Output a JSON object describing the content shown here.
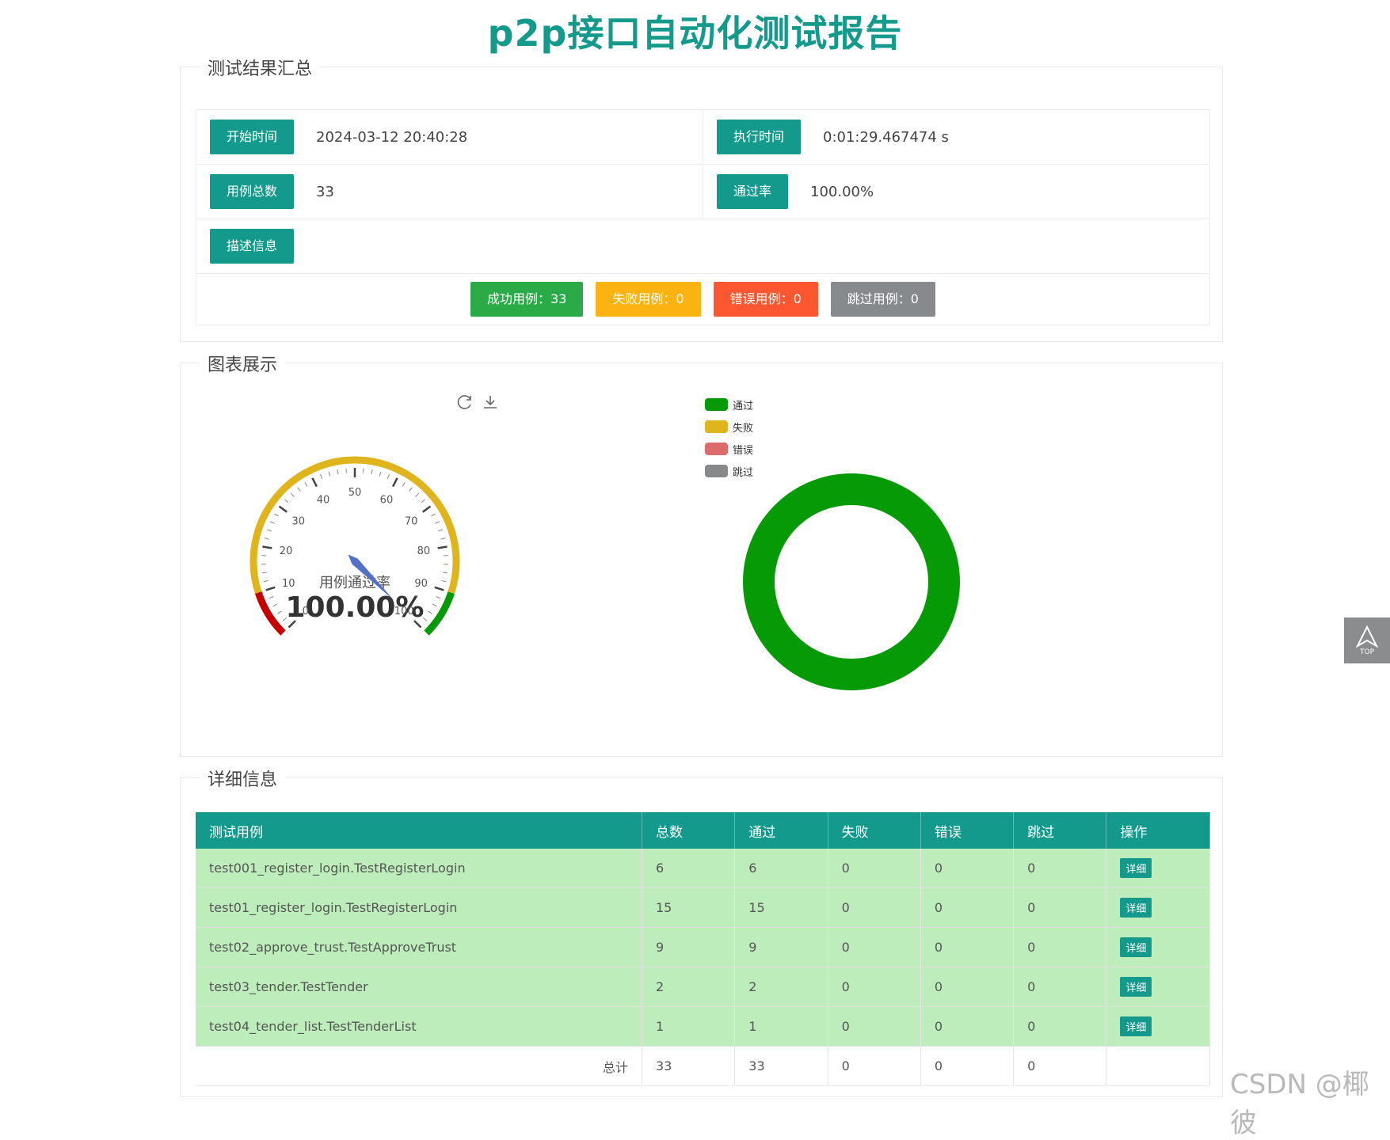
{
  "header": {
    "title": "p2p接口自动化测试报告"
  },
  "summary": {
    "legend": "测试结果汇总",
    "start_label": "开始时间",
    "start_value": "2024-03-12 20:40:28",
    "duration_label": "执行时间",
    "duration_value": "0:01:29.467474 s",
    "total_label": "用例总数",
    "total_value": "33",
    "pass_rate_label": "通过率",
    "pass_rate_value": "100.00%",
    "desc_label": "描述信息",
    "badges": {
      "pass": "成功用例：33",
      "fail": "失败用例：0",
      "error": "错误用例：0",
      "skip": "跳过用例：0"
    }
  },
  "charts": {
    "legend": "图表展示",
    "gauge_label": "用例通过率",
    "gauge_value_text": "100.00%",
    "gauge_ticks": [
      "0",
      "10",
      "20",
      "30",
      "40",
      "50",
      "60",
      "70",
      "80",
      "90",
      "100"
    ],
    "donut_legend": [
      "通过",
      "失败",
      "错误",
      "跳过"
    ]
  },
  "chart_data": [
    {
      "type": "gauge",
      "title": "用例通过率",
      "value": 100.0,
      "range": [
        0,
        100
      ],
      "bands": [
        {
          "to": 10,
          "color": "#c40000"
        },
        {
          "to": 90,
          "color": "#e0b41d"
        },
        {
          "to": 100,
          "color": "#079a07"
        }
      ]
    },
    {
      "type": "pie",
      "categories": [
        "通过",
        "失败",
        "错误",
        "跳过"
      ],
      "values": [
        33,
        0,
        0,
        0
      ],
      "colors": [
        "#079a07",
        "#e0b41d",
        "#dc6b6b",
        "#87898b"
      ],
      "legend": "top-left"
    }
  ],
  "detail": {
    "legend": "详细信息",
    "columns": [
      "测试用例",
      "总数",
      "通过",
      "失败",
      "错误",
      "跳过",
      "操作"
    ],
    "button_label": "详细",
    "rows": [
      [
        "test001_register_login.TestRegisterLogin",
        "6",
        "6",
        "0",
        "0",
        "0"
      ],
      [
        "test01_register_login.TestRegisterLogin",
        "15",
        "15",
        "0",
        "0",
        "0"
      ],
      [
        "test02_approve_trust.TestApproveTrust",
        "9",
        "9",
        "0",
        "0",
        "0"
      ],
      [
        "test03_tender.TestTender",
        "2",
        "2",
        "0",
        "0",
        "0"
      ],
      [
        "test04_tender_list.TestTenderList",
        "1",
        "1",
        "0",
        "0",
        "0"
      ]
    ],
    "total": [
      "总计",
      "33",
      "33",
      "0",
      "0",
      "0"
    ]
  },
  "watermark": "CSDN @椰彼",
  "to_top_label": "TOP",
  "colors": {
    "accent": "#139a8d",
    "row_pass": "#bdedbb"
  }
}
